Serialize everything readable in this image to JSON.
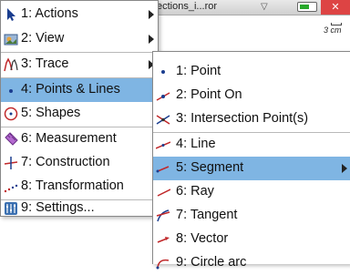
{
  "document": {
    "title": "ections_i...ror",
    "scale_label": "3 cm"
  },
  "main_menu": {
    "items": [
      {
        "label": "1: Actions",
        "icon": "pointer-arrow-icon",
        "submenu": true
      },
      {
        "label": "2: View",
        "icon": "view-icon",
        "submenu": true
      },
      {
        "label": "3: Trace",
        "icon": "trace-icon",
        "submenu": true
      },
      {
        "label": "4: Points & Lines",
        "icon": "point-icon",
        "submenu": true,
        "selected": true
      },
      {
        "label": "5: Shapes",
        "icon": "circle-shape-icon",
        "submenu": true
      },
      {
        "label": "6: Measurement",
        "icon": "ruler-icon",
        "submenu": true
      },
      {
        "label": "7: Construction",
        "icon": "construction-icon",
        "submenu": true
      },
      {
        "label": "8: Transformation",
        "icon": "transformation-icon",
        "submenu": true
      },
      {
        "label": "9: Settings...",
        "icon": "settings-icon",
        "submenu": false
      }
    ]
  },
  "sub_menu": {
    "items": [
      {
        "label": "1: Point",
        "icon": "point-icon"
      },
      {
        "label": "2: Point On",
        "icon": "point-on-icon"
      },
      {
        "label": "3: Intersection Point(s)",
        "icon": "intersection-icon"
      },
      {
        "label": "4: Line",
        "icon": "line-icon"
      },
      {
        "label": "5: Segment",
        "icon": "segment-icon",
        "selected": true,
        "submenu": true
      },
      {
        "label": "6: Ray",
        "icon": "ray-icon"
      },
      {
        "label": "7: Tangent",
        "icon": "tangent-icon"
      },
      {
        "label": "8: Vector",
        "icon": "vector-icon"
      },
      {
        "label": "9: Circle arc",
        "icon": "circle-arc-icon"
      }
    ]
  },
  "colors": {
    "highlight": "#7fb5e3",
    "close": "#dd4444",
    "battery": "#27a82a"
  }
}
